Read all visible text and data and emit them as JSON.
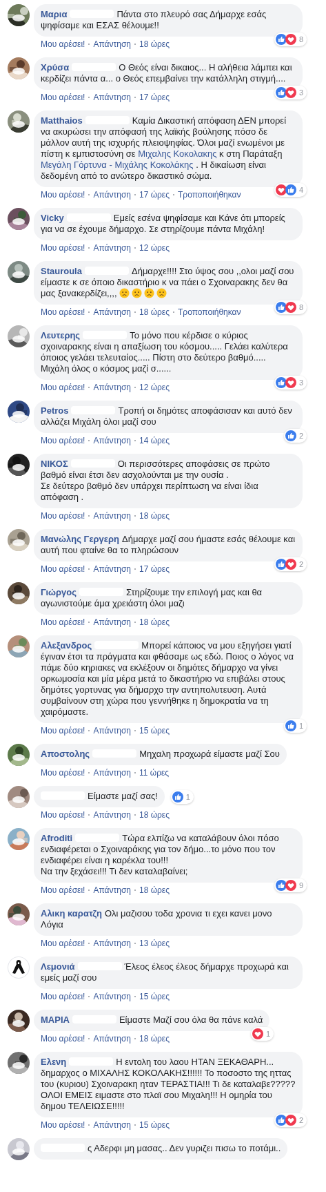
{
  "comments": [
    {
      "name": "Μαρια",
      "redacted": true,
      "avatar": {
        "kind": "picture"
      },
      "body": [
        {
          "kind": "text",
          "text": "Πάντα στο πλευρό σας Δήμαρχε εσάς ψηφίσαμε και ΕΣΑΣ θέλουμε!!"
        }
      ],
      "actions": {
        "like": "Μου αρέσει!",
        "reply": "Απάντηση",
        "time": "18 ώρες"
      },
      "reactions": [
        {
          "kind": "like"
        },
        {
          "kind": "love"
        }
      ],
      "reaction_count": "8"
    },
    {
      "name": "Χρύσα",
      "redacted": true,
      "avatar": {
        "kind": "picture"
      },
      "body": [
        {
          "kind": "text",
          "text": "Ο Θεός είναι δικαιος... Η αλήθεια λάμπει και κερδίζει πάντα α... ο Θεός επεμβαίνει την κατάλληλη στιγμή...."
        }
      ],
      "actions": {
        "like": "Μου αρέσει!",
        "reply": "Απάντηση",
        "time": "17 ώρες"
      },
      "reactions": [
        {
          "kind": "like"
        },
        {
          "kind": "love"
        }
      ],
      "reaction_count": "3"
    },
    {
      "name": "Matthaios",
      "redacted": true,
      "avatar": {
        "kind": "picture"
      },
      "body": [
        {
          "kind": "text",
          "text": "Καμία Δικαστική απόφαση ΔΕΝ μπορεί να ακυρώσει την απόφασή της λαϊκής βούλησης πόσο δε μάλλον αυτή της ισχυρής πλειοψηφίας. Όλοι μαζί ενωμένοι με πίστη κ εμπιστοσύνη σε "
        },
        {
          "kind": "link",
          "text": "Μιχαλης Κοκολακης"
        },
        {
          "kind": "text",
          "text": " κ στη Παράταξη "
        },
        {
          "kind": "link",
          "text": "Μεγάλη Γόρτυνα - Μιχάλης Κοκολάκης"
        },
        {
          "kind": "text",
          "text": " . Η δικαίωση είναι δεδομένη από το ανώτερο δικαστικό σώμα."
        }
      ],
      "actions": {
        "like": "Μου αρέσει!",
        "reply": "Απάντηση",
        "time": "17 ώρες",
        "edited": "Τροποποιήθηκαν"
      },
      "reactions": [
        {
          "kind": "love"
        },
        {
          "kind": "like"
        }
      ],
      "reaction_count": "4"
    },
    {
      "name": "Vicky",
      "redacted": true,
      "avatar": {
        "kind": "picture"
      },
      "body": [
        {
          "kind": "text",
          "text": "Εμείς εσένα ψηφίσαμε και Κάνε ότι μπορείς για να σε έχουμε δήμαρχο. Σε στηρίζουμε πάντα Μιχάλη!"
        }
      ],
      "actions": {
        "like": "Μου αρέσει!",
        "reply": "Απάντηση",
        "time": "12 ώρες"
      }
    },
    {
      "name": "Stauroula",
      "redacted": true,
      "avatar": {
        "kind": "picture"
      },
      "body": [
        {
          "kind": "text",
          "text": "Δήμαρχε!!!! Στο ύψος σου ,,ολοι μαζί σου είμαστε κ σε όποιο δικαστήριο κ να πάει ο Σχοιναρακης δεν θα μας ξανακερδίζει,,,,"
        },
        {
          "kind": "emoji"
        },
        {
          "kind": "emoji"
        },
        {
          "kind": "emoji"
        },
        {
          "kind": "emoji"
        }
      ],
      "actions": {
        "like": "Μου αρέσει!",
        "reply": "Απάντηση",
        "time": "18 ώρες",
        "edited": "Τροποποιήθηκαν"
      },
      "reactions": [
        {
          "kind": "like"
        },
        {
          "kind": "love"
        }
      ],
      "reaction_count": "8"
    },
    {
      "name": "Λευτερης",
      "redacted": true,
      "avatar": {
        "kind": "picture"
      },
      "body": [
        {
          "kind": "text",
          "text": "Το μόνο που κέρδισε ο κύριος σχοιναρακης είναι η απαξίωση του κόσμου..... Γελάει καλύτερα όποιος γελάει τελευταίος..... Πίστη στο δεύτερο βαθμό..... Μιχάλη όλος ο κόσμος μαζί σ......"
        }
      ],
      "actions": {
        "like": "Μου αρέσει!",
        "reply": "Απάντηση",
        "time": "12 ώρες"
      },
      "reactions": [
        {
          "kind": "like"
        },
        {
          "kind": "love"
        }
      ],
      "reaction_count": "3"
    },
    {
      "name": "Petros",
      "redacted": true,
      "avatar": {
        "kind": "picture"
      },
      "body": [
        {
          "kind": "text",
          "text": "Τροπή οι δημότες αποφάσισαν και αυτό δεν αλλάζει Μιχάλη όλοι μαζί σου"
        }
      ],
      "actions": {
        "like": "Μου αρέσει!",
        "reply": "Απάντηση",
        "time": "14 ώρες"
      },
      "reactions": [
        {
          "kind": "like"
        }
      ],
      "reaction_count": "2"
    },
    {
      "name": "ΝΙΚΟΣ",
      "redacted": true,
      "avatar": {
        "kind": "picture"
      },
      "body": [
        {
          "kind": "text",
          "text": "Οι περισσότερες αποφάσεις σε πρώτο βαθμό είναι έτσι δεν ασχολούνται με την ουσία .\nΣε δεύτερο βαθμό δεν υπάρχει περίπτωση να είναι ίδια απόφαση ."
        }
      ],
      "actions": {
        "like": "Μου αρέσει!",
        "reply": "Απάντηση",
        "time": "18 ώρες"
      }
    },
    {
      "name": "Μανώλης Γεργερη",
      "redacted": false,
      "avatar": {
        "kind": "picture"
      },
      "body": [
        {
          "kind": "text",
          "text": "Δήμαρχε μαζί σου ήμαστε εσάς θέλουμε και αυτή που φταίνε θα το πληρώσουν"
        }
      ],
      "actions": {
        "like": "Μου αρέσει!",
        "reply": "Απάντηση",
        "time": "17 ώρες"
      },
      "reactions": [
        {
          "kind": "like"
        },
        {
          "kind": "love"
        }
      ],
      "reaction_count": "2"
    },
    {
      "name": "Γιώργος",
      "redacted": true,
      "avatar": {
        "kind": "picture"
      },
      "body": [
        {
          "kind": "text",
          "text": "Στηρίζουμε την επιλογή μας και θα αγωνιστούμε άμα χρειάστη όλοι μαζι"
        }
      ],
      "actions": {
        "like": "Μου αρέσει!",
        "reply": "Απάντηση",
        "time": "18 ώρες"
      }
    },
    {
      "name": "Αλεξανδρος",
      "redacted": true,
      "avatar": {
        "kind": "picture"
      },
      "body": [
        {
          "kind": "text",
          "text": "Μπορεί κάποιος να μου εξηγήσει γιατί έγιναν έτσι τα πράγματα και φθάσαμε ως εδώ. Ποιος ο λόγος να πάμε δύο κηριακες να εκλέξουν οι δημότες δήμαρχο να γίνει ορκωμοσία και μία μέρα μετά το δικαστήριο να επιβάλει στους δημότες γορτυνας για δήμαρχο την αντηπολυτευση. Αυτά συμβαίνουν στη χώρα που γεννήθηκε η δημοκρατία να τη χαιρόμαστε."
        }
      ],
      "actions": {
        "like": "Μου αρέσει!",
        "reply": "Απάντηση",
        "time": "15 ώρες"
      },
      "reactions": [
        {
          "kind": "like"
        }
      ],
      "reaction_count": "1"
    },
    {
      "name": "Αποστολης",
      "redacted": true,
      "avatar": {
        "kind": "picture"
      },
      "body": [
        {
          "kind": "text",
          "text": "Μηχαλη προχωρά είμαστε μαζί Σου"
        }
      ],
      "actions": {
        "like": "Μου αρέσει!",
        "reply": "Απάντηση",
        "time": "11 ώρες"
      }
    },
    {
      "redacted": true,
      "avatar": {
        "kind": "picture"
      },
      "body": [
        {
          "kind": "text",
          "text": "Είμαστε μαζί σας!"
        }
      ],
      "actions": {
        "like": "Μου αρέσει!",
        "reply": "Απάντηση",
        "time": "18 ώρες"
      },
      "reactions": [
        {
          "kind": "like"
        }
      ],
      "reaction_count": "1"
    },
    {
      "name": "Afroditi",
      "redacted": true,
      "avatar": {
        "kind": "picture"
      },
      "body": [
        {
          "kind": "text",
          "text": "Τώρα ελπίζω να καταλάβουν όλοι πόσο ενδιαφέρεται ο Σχοιναράκης για τον δήμο...το μόνο που τον ενδιαφέρει είναι η καρέκλα του!!!\nΝα την ξεχάσει!!! Τι δεν καταλαβαίνει;"
        }
      ],
      "actions": {
        "like": "Μου αρέσει!",
        "reply": "Απάντηση",
        "time": "18 ώρες"
      },
      "reactions": [
        {
          "kind": "like"
        },
        {
          "kind": "love"
        }
      ],
      "reaction_count": "9"
    },
    {
      "name": "Αλικη καρατζη",
      "redacted": false,
      "avatar": {
        "kind": "picture"
      },
      "body": [
        {
          "kind": "text",
          "text": "Ολι μαζισου τοδα χρονια τι εχει κανει μονο Λόγια"
        }
      ],
      "actions": {
        "like": "Μου αρέσει!",
        "reply": "Απάντηση",
        "time": "13 ώρες"
      }
    },
    {
      "name": "Λεμονιά",
      "redacted": true,
      "avatar": {
        "kind": "ribbon"
      },
      "body": [
        {
          "kind": "text",
          "text": "Έλεος έλεος έλεος δήμαρχε προχωρά και εμείς μαζί σου"
        }
      ],
      "actions": {
        "like": "Μου αρέσει!",
        "reply": "Απάντηση",
        "time": "15 ώρες"
      }
    },
    {
      "name": "ΜΑΡΙΑ",
      "redacted": true,
      "avatar": {
        "kind": "picture"
      },
      "body": [
        {
          "kind": "text",
          "text": "Είμαστε Μαζί σου όλα θα πάνε καλά"
        }
      ],
      "actions": {
        "like": "Μου αρέσει!",
        "reply": "Απάντηση",
        "time": "18 ώρες"
      },
      "reactions": [
        {
          "kind": "love"
        }
      ],
      "reaction_count": "1"
    },
    {
      "name": "Ελενη",
      "redacted": true,
      "avatar": {
        "kind": "picture"
      },
      "body": [
        {
          "kind": "text",
          "text": "Η εντολη του λαου ΗΤΑΝ ΞΕΚΑΘΑΡΗ... δημαρχος ο ΜΙΧΑΛΗΣ ΚΟΚΟΛΑΚΗΣ!!!!!! Το ποσοστο της ηττας του (κυριου) Σχοιναρακη ηταν ΤΕΡΑΣΤΙΑ!!! Τι δε καταλαβε????? ΟΛΟΙ ΕΜΕΙΣ ειμαστε στο πλαϊ σου Μιχαλη!!! Η ομηρία του δημου ΤΕΛΕΙΩΣΕ!!!!!"
        }
      ],
      "actions": {
        "like": "Μου αρέσει!",
        "reply": "Απάντηση",
        "time": "15 ώρες"
      },
      "reactions": [
        {
          "kind": "like"
        },
        {
          "kind": "love"
        }
      ],
      "reaction_count": "2"
    },
    {
      "redacted": true,
      "avatar": {
        "kind": "picture"
      },
      "body": [
        {
          "kind": "text",
          "text": "ς Αδερφι μη μασας.. Δεν γυριζει πισω το ποτάμι.."
        }
      ]
    }
  ]
}
